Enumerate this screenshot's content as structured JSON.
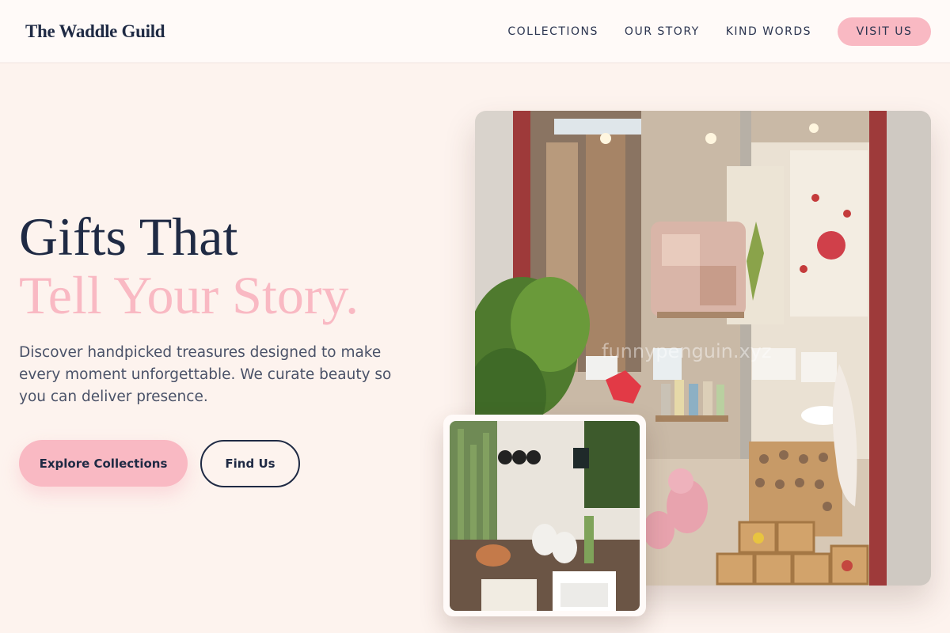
{
  "brand": {
    "name": "The Waddle Guild"
  },
  "nav": {
    "links": [
      "COLLECTIONS",
      "OUR STORY",
      "KIND WORDS"
    ],
    "cta": "VISIT US"
  },
  "hero": {
    "title_line1": "Gifts That",
    "title_line2": "Tell Your Story.",
    "description": "Discover handpicked treasures designed to make every moment unforgettable. We curate beauty so you can deliver presence.",
    "primary_button": "Explore Collections",
    "secondary_button": "Find Us"
  },
  "images": {
    "storefront_alt": "Gift shop window display",
    "storefront_watermark": "funnypenguin.xyz",
    "detail_alt": "Shop interior with plants and ceramics"
  },
  "colors": {
    "background": "#fdf3ee",
    "navy": "#1f2a44",
    "accent_pink": "#f9b9c3",
    "body_text": "#4a5268"
  }
}
